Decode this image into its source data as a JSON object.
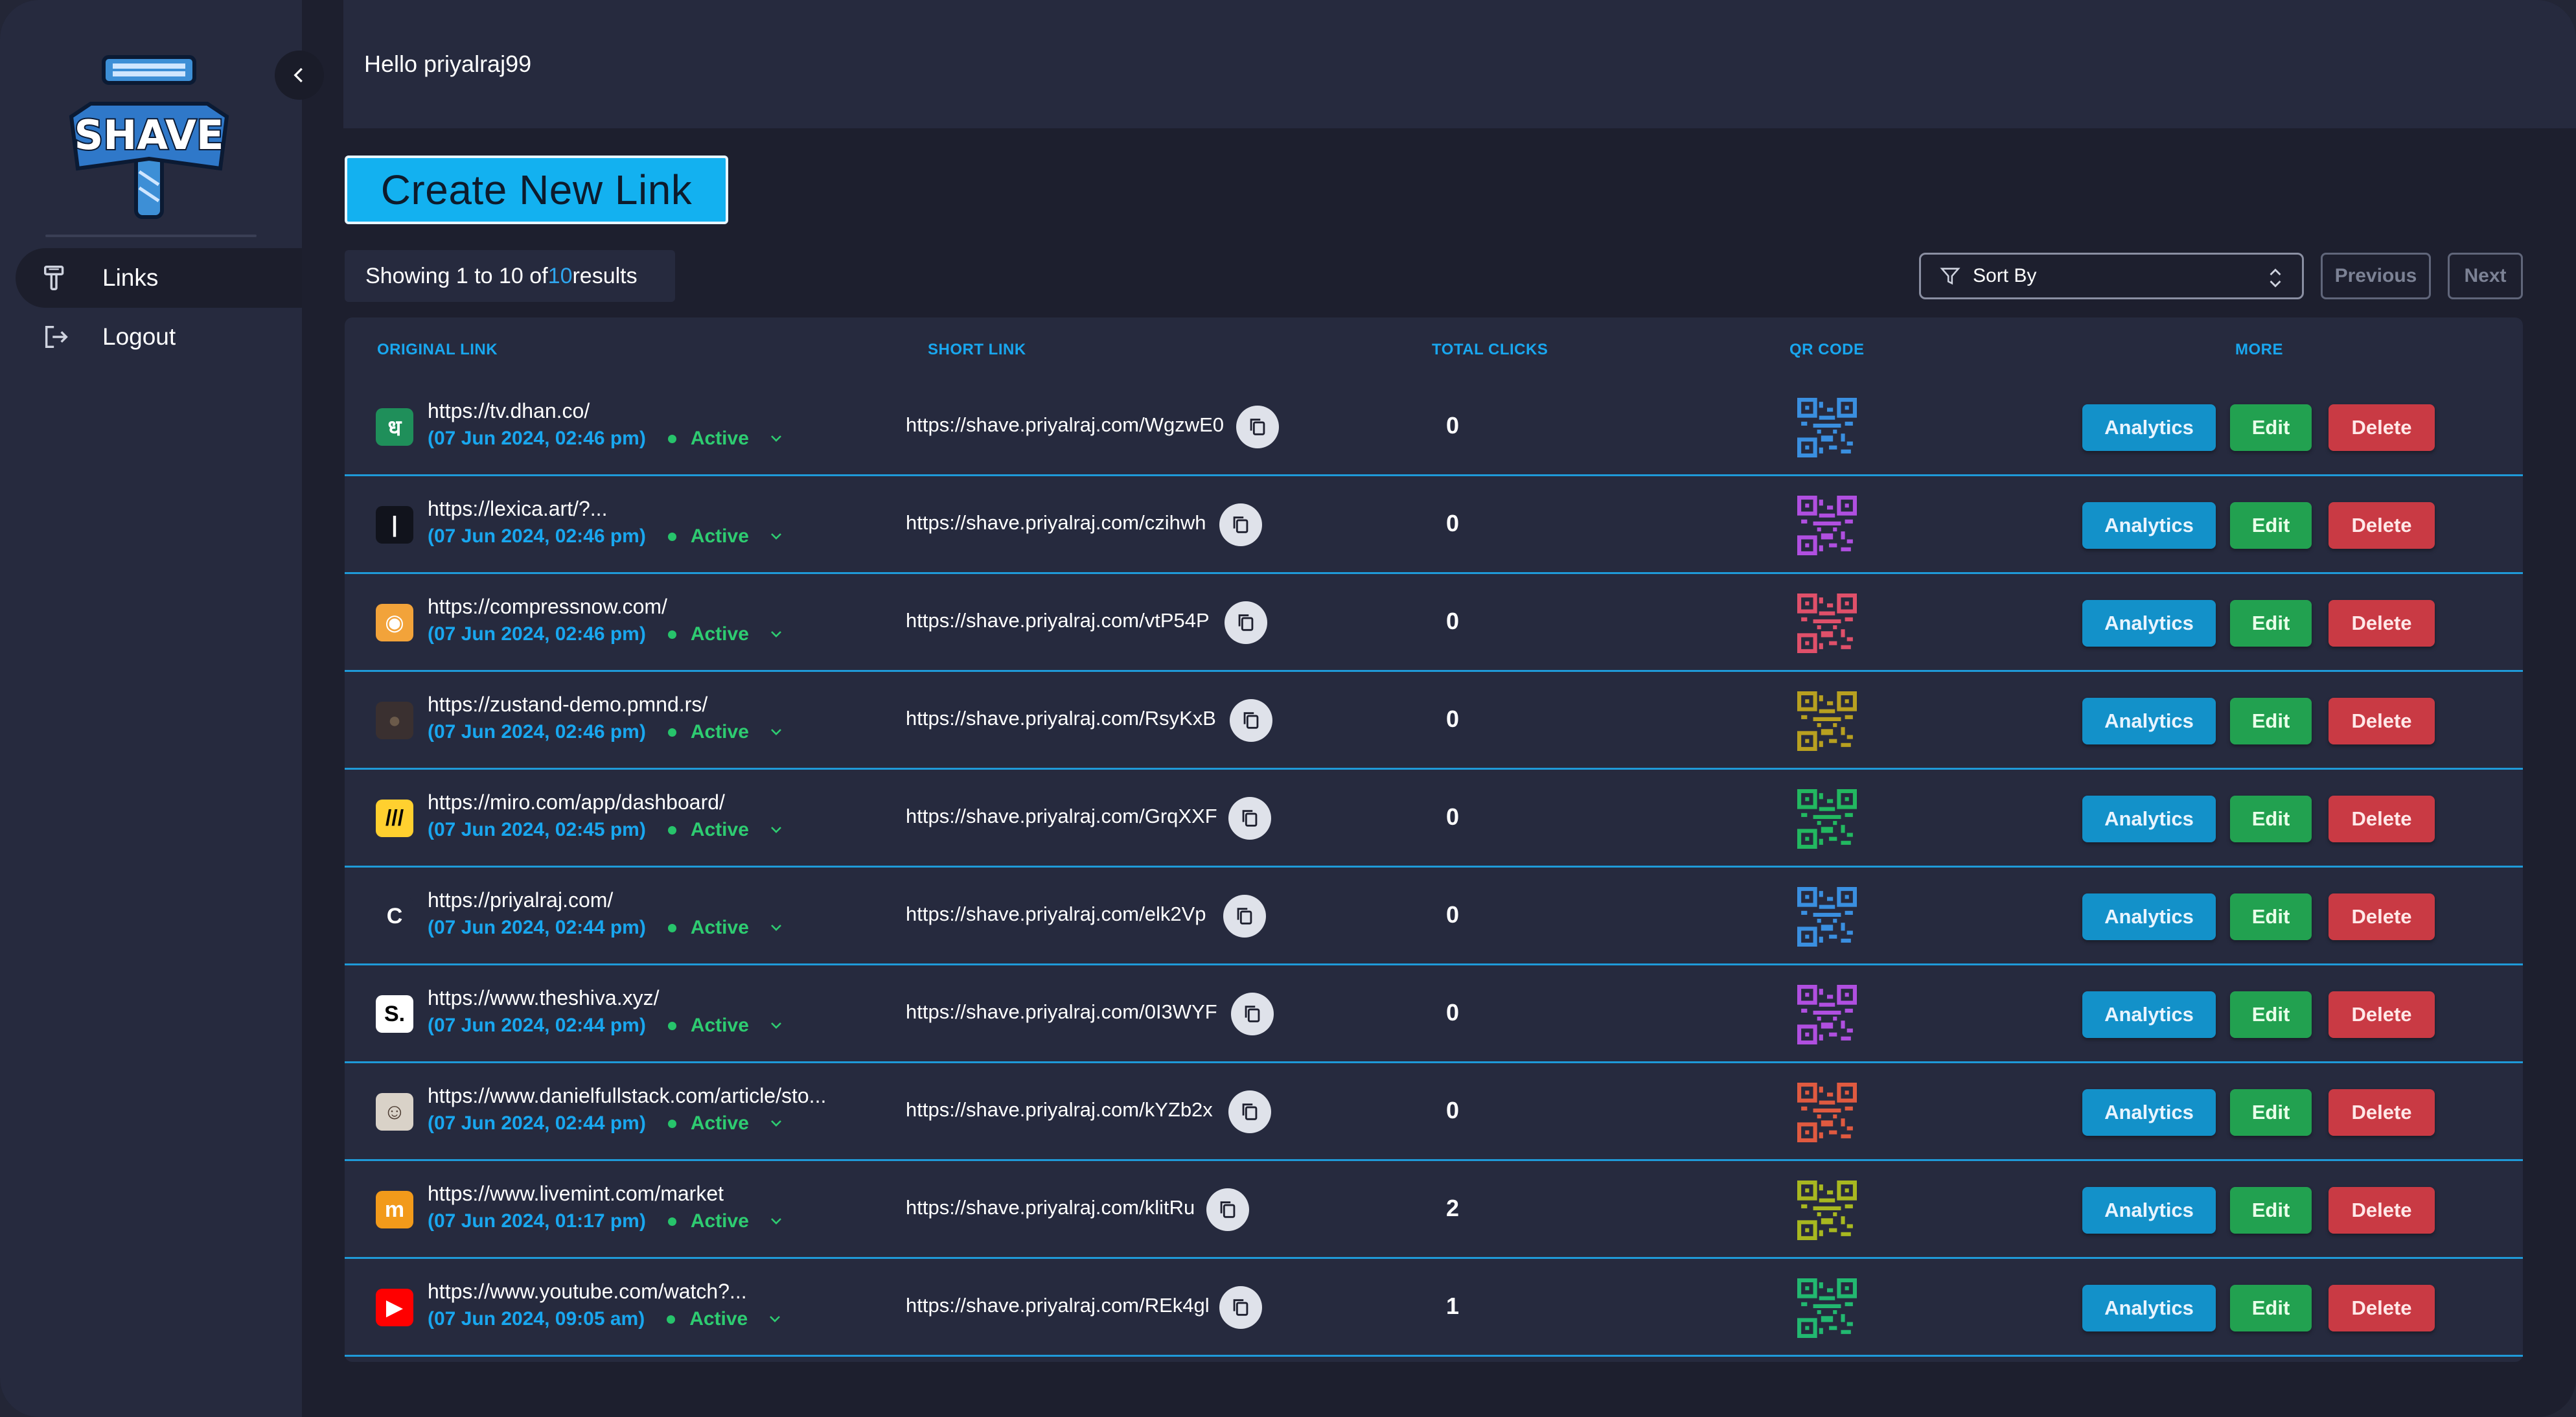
{
  "sidebar": {
    "logo_text": "SHAVE",
    "nav": [
      {
        "label": "Links",
        "icon": "link-icon",
        "active": true
      },
      {
        "label": "Logout",
        "icon": "logout-icon",
        "active": false
      }
    ]
  },
  "header": {
    "greeting": "Hello priyalraj99"
  },
  "toolbar": {
    "create_label": "Create New Link",
    "showing_prefix": "Showing 1 to 10 of ",
    "showing_total": "10",
    "showing_suffix": " results",
    "sort_label": "Sort By",
    "previous_label": "Previous",
    "next_label": "Next"
  },
  "table": {
    "headers": {
      "original": "ORIGINAL LINK",
      "short": "SHORT LINK",
      "clicks": "TOTAL CLICKS",
      "qr": "QR CODE",
      "more": "MORE"
    },
    "actions": {
      "analytics": "Analytics",
      "edit": "Edit",
      "delete": "Delete"
    },
    "rows": [
      {
        "original": "https://tv.dhan.co/",
        "date": "(07 Jun 2024, 02:46 pm)",
        "status": "Active",
        "short": "https://shave.priyalraj.com/WgzwE0",
        "clicks": "0",
        "fav_char": "ध",
        "fav_bg": "#1f8f5a",
        "fav_fg": "#ffffff",
        "qr_color": "#3a8fe0"
      },
      {
        "original": "https://lexica.art/?...",
        "date": "(07 Jun 2024, 02:46 pm)",
        "status": "Active",
        "short": "https://shave.priyalraj.com/czihwh",
        "clicks": "0",
        "fav_char": "|",
        "fav_bg": "#11131c",
        "fav_fg": "#ffffff",
        "qr_color": "#b04fe0"
      },
      {
        "original": "https://compressnow.com/",
        "date": "(07 Jun 2024, 02:46 pm)",
        "status": "Active",
        "short": "https://shave.priyalraj.com/vtP54P",
        "clicks": "0",
        "fav_char": "◉",
        "fav_bg": "#f2a33a",
        "fav_fg": "#ffffff",
        "qr_color": "#e0506a"
      },
      {
        "original": "https://zustand-demo.pmnd.rs/",
        "date": "(07 Jun 2024, 02:46 pm)",
        "status": "Active",
        "short": "https://shave.priyalraj.com/RsyKxB",
        "clicks": "0",
        "fav_char": "●",
        "fav_bg": "#3a3030",
        "fav_fg": "#6b5a4a",
        "qr_color": "#b8a020"
      },
      {
        "original": "https://miro.com/app/dashboard/",
        "date": "(07 Jun 2024, 02:45 pm)",
        "status": "Active",
        "short": "https://shave.priyalraj.com/GrqXXF",
        "clicks": "0",
        "fav_char": "///",
        "fav_bg": "#ffd02f",
        "fav_fg": "#050505",
        "qr_color": "#22b860"
      },
      {
        "original": "https://priyalraj.com/",
        "date": "(07 Jun 2024, 02:44 pm)",
        "status": "Active",
        "short": "https://shave.priyalraj.com/elk2Vp",
        "clicks": "0",
        "fav_char": "C",
        "fav_bg": "#262a3e",
        "fav_fg": "#ffffff",
        "qr_color": "#3a8fe0"
      },
      {
        "original": "https://www.theshiva.xyz/",
        "date": "(07 Jun 2024, 02:44 pm)",
        "status": "Active",
        "short": "https://shave.priyalraj.com/0I3WYF",
        "clicks": "0",
        "fav_char": "S.",
        "fav_bg": "#ffffff",
        "fav_fg": "#000000",
        "qr_color": "#b04fe0"
      },
      {
        "original": "https://www.danielfullstack.com/article/sto...",
        "date": "(07 Jun 2024, 02:44 pm)",
        "status": "Active",
        "short": "https://shave.priyalraj.com/kYZb2x",
        "clicks": "0",
        "fav_char": "☺",
        "fav_bg": "#d9d2c8",
        "fav_fg": "#4a3a30",
        "qr_color": "#e05a40"
      },
      {
        "original": "https://www.livemint.com/market",
        "date": "(07 Jun 2024, 01:17 pm)",
        "status": "Active",
        "short": "https://shave.priyalraj.com/klitRu",
        "clicks": "2",
        "fav_char": "m",
        "fav_bg": "#f29a1a",
        "fav_fg": "#ffffff",
        "qr_color": "#a8b820"
      },
      {
        "original": "https://www.youtube.com/watch?...",
        "date": "(07 Jun 2024, 09:05 am)",
        "status": "Active",
        "short": "https://shave.priyalraj.com/REk4gl",
        "clicks": "1",
        "fav_char": "▶",
        "fav_bg": "#ff0000",
        "fav_fg": "#ffffff",
        "qr_color": "#22b870"
      }
    ]
  },
  "colors": {
    "accent": "#13b1f0",
    "link_blue": "#19a7ef",
    "active_green": "#2ecc71",
    "analytics": "#1391c9",
    "edit": "#22a150",
    "delete": "#c93a44"
  }
}
